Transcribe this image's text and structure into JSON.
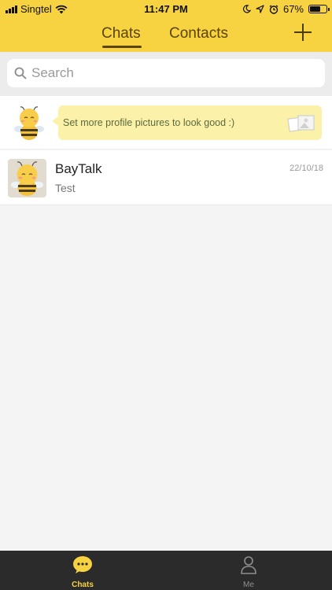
{
  "status_bar": {
    "carrier": "Singtel",
    "time": "11:47 PM",
    "battery": "67%",
    "battery_level": 0.67
  },
  "header": {
    "tabs": [
      {
        "label": "Chats",
        "active": true
      },
      {
        "label": "Contacts",
        "active": false
      }
    ],
    "add_icon": "plus-icon"
  },
  "search": {
    "placeholder": "Search"
  },
  "profile_tip": {
    "text": "Set more profile pictures to look good :)"
  },
  "chats": [
    {
      "name": "BayTalk",
      "last_message": "Test",
      "date": "22/10/18"
    }
  ],
  "bottom_nav": {
    "items": [
      {
        "label": "Chats",
        "icon": "chat-bubble-icon",
        "active": true
      },
      {
        "label": "Me",
        "icon": "person-icon",
        "active": false
      }
    ]
  },
  "colors": {
    "brand_yellow": "#f7d241",
    "bottom_bar": "#2b2b2b",
    "tip_bubble": "#fbf1a8"
  }
}
